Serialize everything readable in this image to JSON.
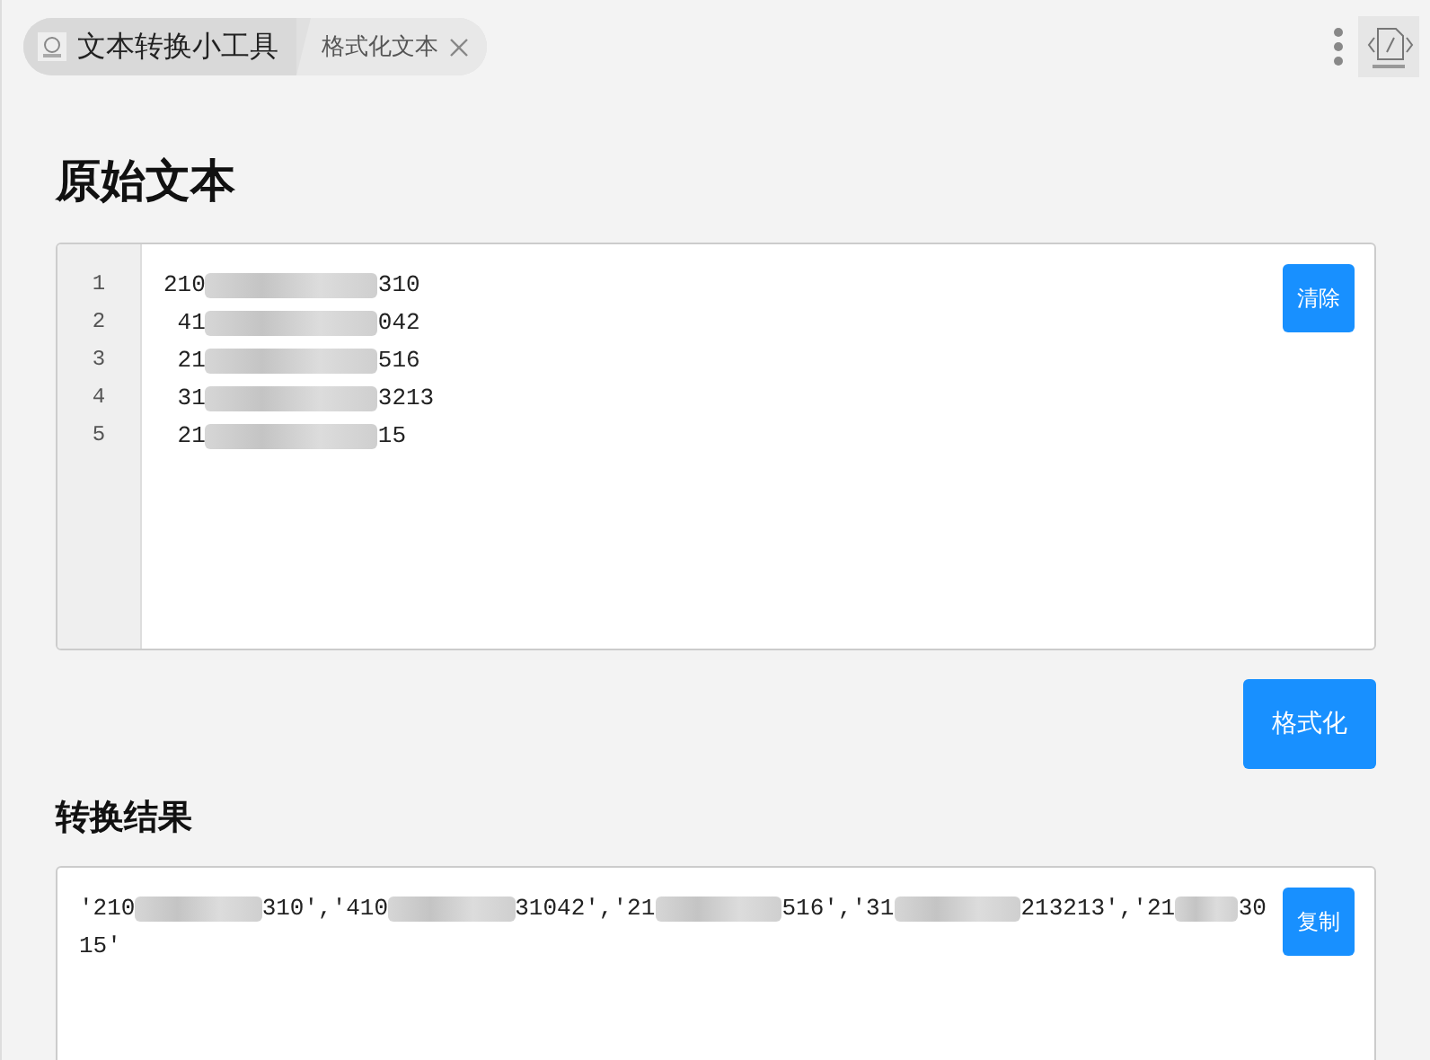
{
  "tabs": [
    {
      "label": "文本转换小工具",
      "kind": "home",
      "selected": false
    },
    {
      "label": "格式化文本",
      "kind": "page",
      "selected": true
    }
  ],
  "source": {
    "title": "原始文本",
    "clear_button": "清除",
    "lines": [
      {
        "number": "1",
        "start": "210",
        "end": "310"
      },
      {
        "number": "2",
        "start": " 41",
        "end": "042"
      },
      {
        "number": "3",
        "start": " 21",
        "end": "516"
      },
      {
        "number": "4",
        "start": " 31",
        "end": "3213"
      },
      {
        "number": "5",
        "start": " 21",
        "end": "15"
      }
    ]
  },
  "format_button": "格式化",
  "result": {
    "title": "转换结果",
    "copy_button": "复制",
    "segments": [
      "'210",
      "310','410",
      "31042','21",
      "516','31",
      "213213','21",
      "30"
    ],
    "tail": "15'"
  }
}
